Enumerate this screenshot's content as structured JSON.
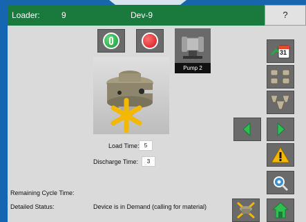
{
  "header": {
    "loader_label": "Loader:",
    "loader_number": "9",
    "device_name": "Dev-9",
    "help_label": "?"
  },
  "pump": {
    "label": "Pump 2"
  },
  "settings": {
    "load_time_label": "Load Time:",
    "load_time_value": "5",
    "discharge_time_label": "Discharge Time:",
    "discharge_time_value": "3"
  },
  "status": {
    "remaining_label": "Remaining Cycle Time:",
    "detailed_label": "Detailed Status:",
    "detailed_value": "Device is in Demand (calling for material)"
  },
  "calendar": {
    "day": "31"
  },
  "colors": {
    "header": "#1a7a3e",
    "accent_green": "#27a845",
    "stop_red": "#d11818",
    "alarm_yellow": "#f5b800",
    "demand_star": "#f5b800"
  },
  "icons": [
    "power-icon",
    "stop-icon",
    "calendar-icon",
    "loaders-icon",
    "receivers-icon",
    "arrow-left-icon",
    "arrow-right-icon",
    "warning-icon",
    "settings-icon",
    "device-demand-icon",
    "home-icon"
  ]
}
